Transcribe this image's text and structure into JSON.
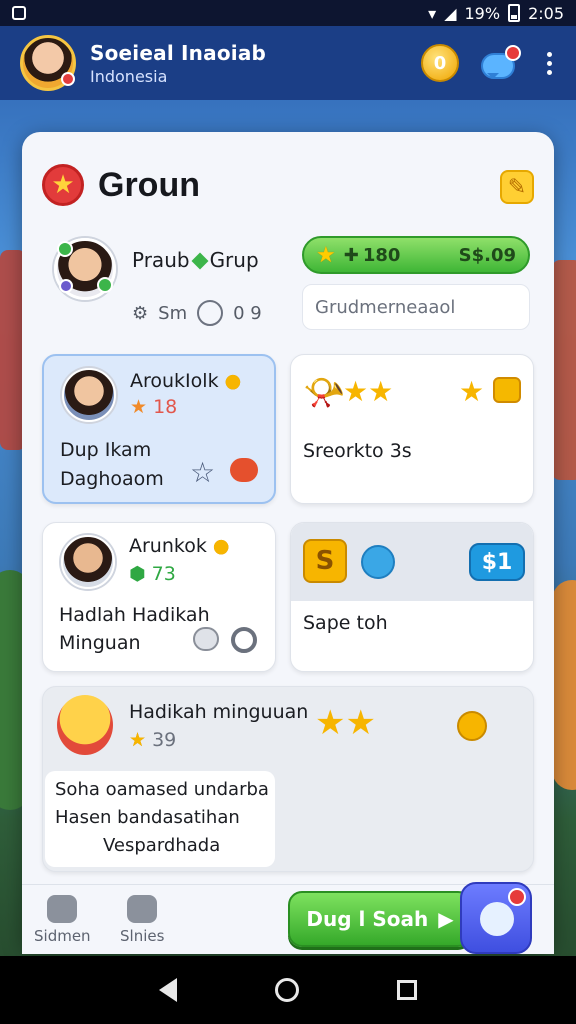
{
  "status_bar": {
    "battery": "19%",
    "time": "2:05"
  },
  "header": {
    "title": "Soeieal Inaoiab",
    "subtitle": "Indonesia",
    "coin_glyph": "0"
  },
  "group": {
    "title": "Groun",
    "profile_name": "Praub",
    "profile_tag": "Grup",
    "profile_stat_1": "Sm",
    "profile_stat_2": "0 9",
    "progress": {
      "level": "180",
      "amount": "S$.09"
    },
    "search_placeholder": "Grudmerneaaol"
  },
  "cards": [
    {
      "name": "AroukIolk",
      "stat": "18",
      "line1": "Dup Ikam",
      "line2": "Daghoaom"
    },
    {
      "line1": "Sreorkto 3s"
    },
    {
      "name": "Arunkok",
      "stat": "73",
      "line1": "Hadlah Hadikah",
      "line2": "Minguan"
    },
    {
      "badge": "$1",
      "line1": "Sape toh"
    },
    {
      "name": "Hadikah minguuan",
      "stat": "39",
      "note_line1": "Soha oamased undarba",
      "note_line2": "Hasen bandasatihan",
      "note_line3": "Vespardhada"
    }
  ],
  "bottom_nav": {
    "item1": "Sidmen",
    "item2": "Slnies",
    "play_label": "Dug l Soah"
  },
  "colors": {
    "accent_green": "#3fb636",
    "header_blue": "#1b3e86",
    "panel_bg": "#f4f6fb",
    "gold": "#f7b500"
  }
}
